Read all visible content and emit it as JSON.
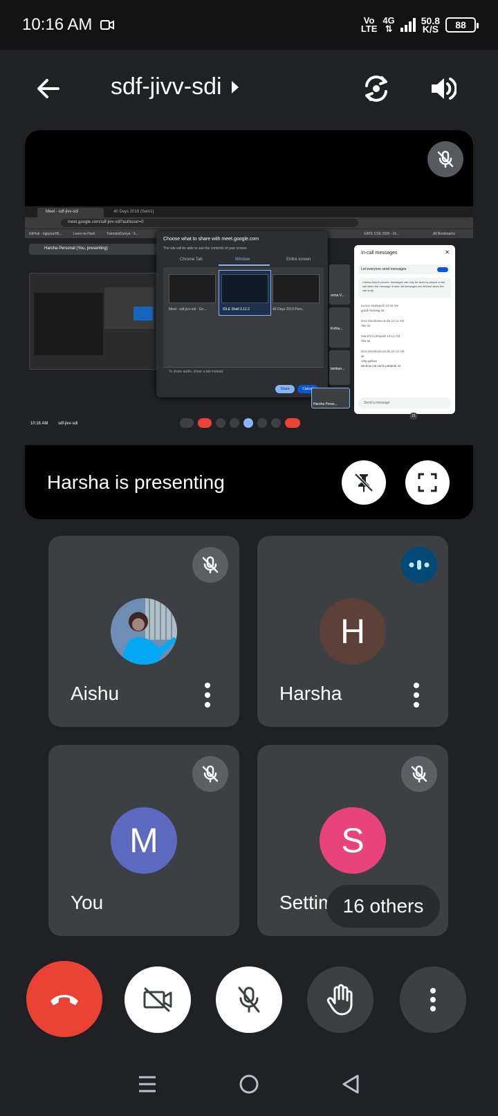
{
  "status_bar": {
    "time": "10:16 AM",
    "volte_top": "Vo",
    "volte_bottom": "LTE",
    "network_type": "4G",
    "speed_value": "50.8",
    "speed_unit": "K/S",
    "battery": "88"
  },
  "header": {
    "meeting_code": "sdf-jivv-sdi"
  },
  "presentation": {
    "label": "Harsha is presenting",
    "shared_screen": {
      "tab1": "Meet - sdf-jivv-sdi",
      "tab2": "40 Days 2019 (Sem1)",
      "url": "meet.google.com/sdf-jivv-sdi?authuser=0",
      "bookmarks": [
        "GitHub - kgpyour95...",
        "Learn-to-Hack",
        "TutorialsDuniya - 5...",
        "GATE CSE 2025 - Dr...",
        "All Bookmarks"
      ],
      "self_view_title": "Harsha Personal (You, presenting)",
      "dialog_title": "Choose what to share with meet.google.com",
      "dialog_sub": "The site will be able to see the contents of your screen",
      "dialog_tabs": [
        "Chrome Tab",
        "Window",
        "Entire screen"
      ],
      "dialog_items": [
        "Meet - sdf-jivv-sdi - Go...",
        "IDLE Shell 3.12.2",
        "40 Days 2019 Pers..."
      ],
      "dialog_audio": "To share audio, share a tab instead",
      "share_btn": "Share",
      "cancel_btn": "Cancel",
      "tile_labels": [
        "orma V...",
        "Kotha...",
        "lamkan..."
      ],
      "presenter_tile": "Harsha Perso...",
      "bottom_time": "10:16 AM",
      "bottom_code": "sdf-jivv-sdi",
      "participant_badge": "21",
      "chat": {
        "title": "In-call messages",
        "toggle_label": "Let everyone send messages",
        "notice": "Unless they're pinned, messages can only be seen by people in the call when the message is sent. All messages are deleted when the call ends.",
        "messages": [
          {
            "sender": "Kumar Mattapalli  10:06 AM",
            "text": "good morning sir"
          },
          {
            "sender": "Devi Manikanta Bolla  10:11 AM",
            "text": "Yes sir"
          },
          {
            "sender": "Maruthi Kothapalli  10:12 AM",
            "text": "Yes sir"
          },
          {
            "sender": "Devi Manikanta Bolla  10:13 AM",
            "text": "sir"
          },
          {
            "sender": "",
            "text": "only python"
          },
          {
            "sender": "",
            "text": "window ela vachi pettandi sir"
          }
        ],
        "input_placeholder": "Send a message"
      }
    }
  },
  "participants": [
    {
      "name": "Aishu",
      "initial": "",
      "color": "#1e88e5"
    },
    {
      "name": "Harsha",
      "initial": "H",
      "color": "#5d4037"
    },
    {
      "name": "You",
      "initial": "M",
      "color": "#5c6bc0"
    },
    {
      "name": "Settim",
      "initial": "S",
      "color": "#e8437a"
    }
  ],
  "others_label": "16 others",
  "colors": {
    "end_call": "#ea4335",
    "tile_bg": "#3c4043",
    "speaking_badge": "#004a77"
  }
}
